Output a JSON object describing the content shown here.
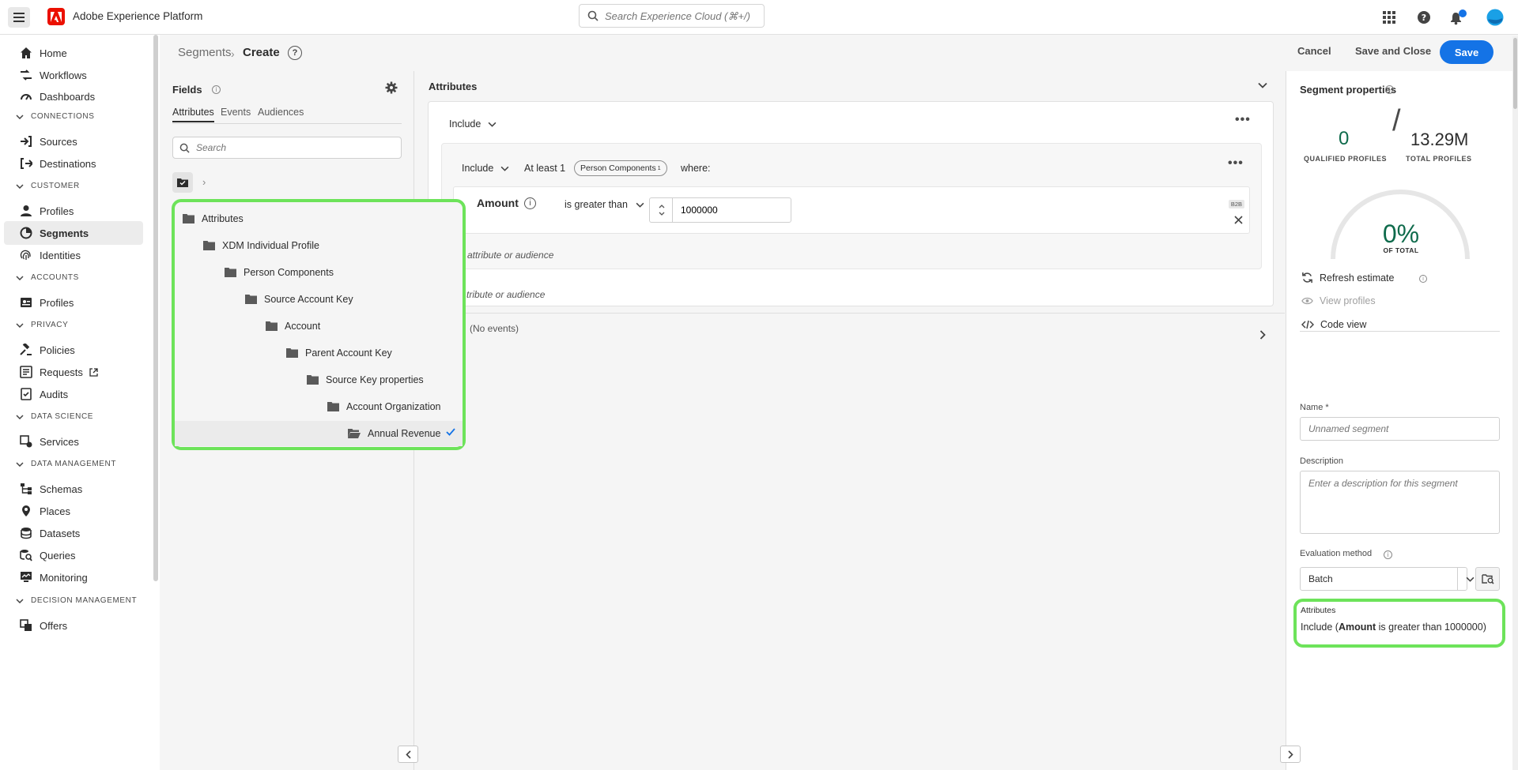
{
  "app": {
    "title": "Adobe Experience Platform"
  },
  "search": {
    "placeholder": "Search Experience Cloud (⌘+/)"
  },
  "sidebar": {
    "home": "Home",
    "workflows": "Workflows",
    "dashboards": "Dashboards",
    "sec_connections": "CONNECTIONS",
    "sources": "Sources",
    "destinations": "Destinations",
    "sec_customer": "CUSTOMER",
    "profiles": "Profiles",
    "segments": "Segments",
    "identities": "Identities",
    "sec_accounts": "ACCOUNTS",
    "acc_profiles": "Profiles",
    "sec_privacy": "PRIVACY",
    "policies": "Policies",
    "requests": "Requests",
    "audits": "Audits",
    "sec_datascience": "DATA SCIENCE",
    "services": "Services",
    "sec_datamgmt": "DATA MANAGEMENT",
    "schemas": "Schemas",
    "places": "Places",
    "datasets": "Datasets",
    "queries": "Queries",
    "monitoring": "Monitoring",
    "sec_decision": "DECISION MANAGEMENT",
    "offers": "Offers"
  },
  "header": {
    "breadcrumb_parent": "Segments",
    "breadcrumb_current": "Create",
    "cancel": "Cancel",
    "save_close": "Save and Close",
    "save": "Save"
  },
  "fields": {
    "title": "Fields",
    "tabs": [
      "Attributes",
      "Events",
      "Audiences"
    ],
    "search_placeholder": "Search",
    "tree": [
      "Attributes",
      "XDM Individual Profile",
      "Person Components",
      "Source Account Key",
      "Account",
      "Parent Account Key",
      "Source Key properties",
      "Account Organization",
      "Annual Revenue"
    ]
  },
  "canvas": {
    "title": "Attributes",
    "include_outer": "Include",
    "include_inner": "Include",
    "at_least": "At least 1",
    "pill": "Person Components",
    "pill_sup": "1",
    "where": "where:",
    "rule_attr": "Amount",
    "rule_op": "is greater than",
    "rule_value": "1000000",
    "rule_badge": "B2B",
    "add_inner": "attribute or audience",
    "add_outer": "tribute or audience",
    "no_events": "(No events)"
  },
  "props": {
    "title": "Segment properties",
    "qualified": "0",
    "qualified_label": "QUALIFIED PROFILES",
    "total": "13.29M",
    "total_label": "TOTAL PROFILES",
    "percent": "0%",
    "percent_label": "OF TOTAL",
    "percent_value": 0,
    "refresh": "Refresh estimate",
    "view_profiles": "View profiles",
    "code_view": "Code view",
    "name_label": "Name *",
    "name_placeholder": "Unnamed segment",
    "desc_label": "Description",
    "desc_placeholder": "Enter a description for this segment",
    "eval_label": "Evaluation method",
    "eval_value": "Batch",
    "summary_title": "Attributes",
    "summary_prefix": "Include (",
    "summary_bold": "Amount",
    "summary_suffix": " is greater than 1000000)"
  },
  "colors": {
    "accent": "#1473e6",
    "highlight": "#6de35a",
    "positive": "#0f6b4c",
    "brand": "#eb1000"
  }
}
